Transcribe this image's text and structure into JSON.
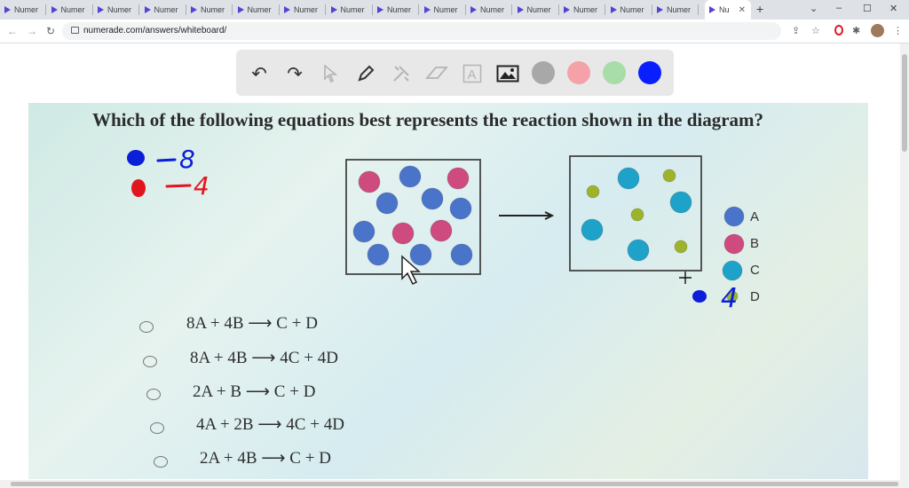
{
  "browser": {
    "tabs": [
      {
        "label": "Numer"
      },
      {
        "label": "Numer"
      },
      {
        "label": "Numer"
      },
      {
        "label": "Numer"
      },
      {
        "label": "Numer"
      },
      {
        "label": "Numer"
      },
      {
        "label": "Numer"
      },
      {
        "label": "Numer"
      },
      {
        "label": "Numer"
      },
      {
        "label": "Numer"
      },
      {
        "label": "Numer"
      },
      {
        "label": "Numer"
      },
      {
        "label": "Numer"
      },
      {
        "label": "Numer"
      },
      {
        "label": "Numer"
      }
    ],
    "active_tab": {
      "label": "Nu"
    },
    "new_tab": "+",
    "back": "←",
    "forward": "→",
    "reload": "↻",
    "url": "numerade.com/answers/whiteboard/",
    "minimize": "–",
    "maximize": "☐",
    "close": "✕",
    "menu": "⋮",
    "chevron": "⌄"
  },
  "toolbar": {
    "undo": "↶",
    "redo": "↷",
    "colors": [
      "#a8a8a8",
      "#f4a1a7",
      "#a8dca8",
      "#0a1fff"
    ]
  },
  "question": "Which of the following equations best represents the reaction shown in the diagram?",
  "legend": [
    "A",
    "B",
    "C",
    "D"
  ],
  "options": [
    "8A + 4B ⟶ C + D",
    "8A + 4B ⟶ 4C + 4D",
    "2A + B ⟶ C + D",
    "4A + 2B ⟶ 4C + 4D",
    "2A + 4B ⟶ C + D"
  ],
  "annotations": {
    "blue_count": "8",
    "red_count": "4",
    "product_count": "4"
  },
  "colors": {
    "molecule_a": "#4a74c9",
    "molecule_b": "#cf4a7e",
    "molecule_c": "#1fa2c9",
    "molecule_d": "#9db32a",
    "ink_blue": "#0b1fd8",
    "ink_red": "#e2151e"
  }
}
